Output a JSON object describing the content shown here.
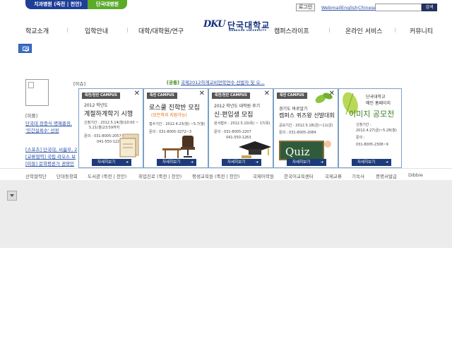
{
  "top": {
    "hospital_1": "치과병원 (죽전 | 천안)",
    "hospital_2": "단국대병원",
    "login": "로그인",
    "links": [
      "Webmail",
      "English",
      "Chinese"
    ],
    "search_button": "검색"
  },
  "logo": {
    "mark": "DKU",
    "korean": "단국대학교",
    "english": "DANKOOK UNIVERSITY"
  },
  "gnb": [
    "학교소개",
    "입학안내",
    "대학/대학원/연구",
    "캠퍼스라이프",
    "온라인 서비스",
    "커뮤니티"
  ],
  "left": {
    "issue_label": "[이슈]",
    "people_label": "[피플]",
    "people_line1": "단국대 장충식 명예총장,",
    "people_line2": "'인간실록수' 선정",
    "sports_line": "[스포츠] 단국대, 씨름부, 2",
    "exchange_line": "[교류협력] 국립 라오스 보",
    "memorial_line": "[미들] 문학평론가 권영민"
  },
  "notice": {
    "label": "[공통]",
    "text": "국제2012하계교비연학연수 선발자 및 오..."
  },
  "banners": [
    {
      "tag": "죽전/천안 CAMPUS",
      "line1": "2012 학년도",
      "line2": "계절하계학기 시행",
      "info": [
        "신청기간 : 2012.5.14(월)10:00 ~",
        "5.21(월)23:59까지",
        "문의 : 031-8005-2057~",
        "041-550-1223"
      ],
      "more": "자세히보기"
    },
    {
      "tag": "죽전 CAMPUS",
      "line1": "로스쿨 진학반 모집",
      "line2": "(모든학과 지원가능)",
      "info": [
        "접수기간 : 2012.4.23(월) ~5.7(월)",
        "문의 : 031-8005-3272~3"
      ],
      "more": "자세히보기"
    },
    {
      "tag": "죽전/천안 CAMPUS",
      "line1": "2012 학년도 대학원 후기",
      "line2": "신·편입생 모집",
      "info": [
        "원서접수 : 2012.5.10(목) ~ 17(목)",
        "문의 : 031-8005-2207",
        "041-550-1263"
      ],
      "more": "자세히보기"
    },
    {
      "tag": "죽전 CAMPUS",
      "line1": "경기도 바로알기",
      "line2": "캠퍼스 퀴즈왕 선발대회",
      "info": [
        "공모기간 : 2012.5.18(금)~11(금)",
        "문의 : 031-8005-2084"
      ],
      "more": "자세히보기",
      "board_text": "Quiz"
    },
    {
      "tag": "",
      "line1": "단국대학교",
      "line2": "메인 홈페이지",
      "line3": "이미지 공모전",
      "info": [
        "신청기간 :",
        "2012.4.27(금)~5.28(월)",
        "문의 :",
        "031-8005-2308~9"
      ],
      "more": "자세히보기"
    }
  ],
  "quick_links": [
    "산학협력단",
    "단대동창회",
    "도서관 (죽전 | 천안)",
    "취업진로 (죽전 | 천안)",
    "평생교육원 (죽전 | 천안)",
    "국제어학원",
    "한국어교육센터",
    "국제교류",
    "기숙사",
    "증명서발급",
    "Dibbie"
  ],
  "colors": {
    "brand_blue": "#1e3f97",
    "brand_green": "#5bab2b",
    "link_blue": "#2a4fa6",
    "accent_orange": "#e36b0c"
  }
}
